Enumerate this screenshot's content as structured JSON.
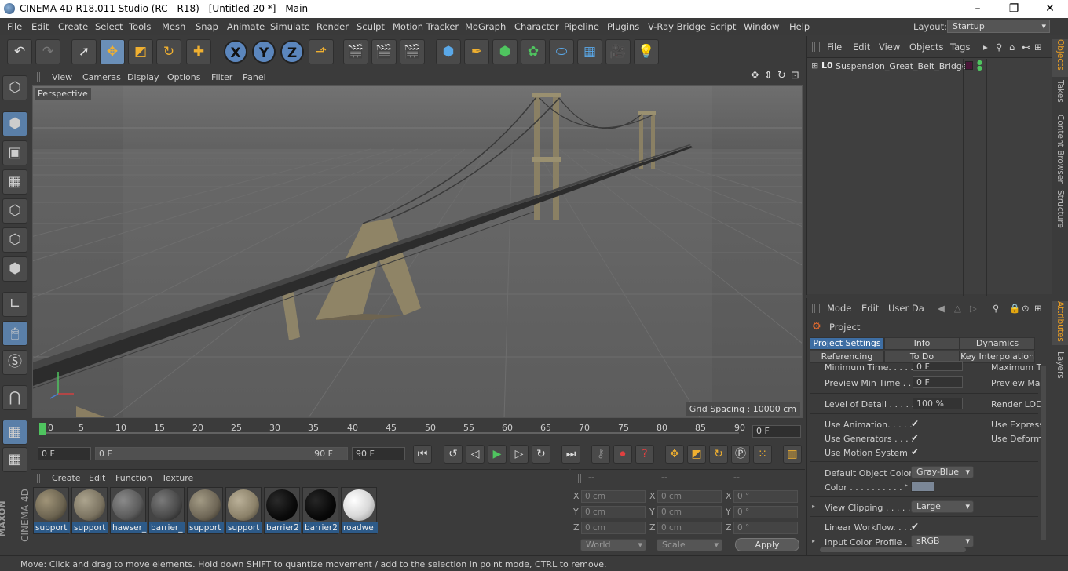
{
  "window": {
    "title": "CINEMA 4D R18.011 Studio (RC - R18) - [Untitled 20 *] - Main",
    "minimize": "–",
    "maximize": "❐",
    "close": "✕"
  },
  "menubar": {
    "items": [
      "File",
      "Edit",
      "Create",
      "Select",
      "Tools",
      "Mesh",
      "Snap",
      "Animate",
      "Simulate",
      "Render",
      "Sculpt",
      "Motion Tracker",
      "MoGraph",
      "Character",
      "Pipeline",
      "Plugins",
      "V-Ray Bridge",
      "Script",
      "Window",
      "Help"
    ],
    "layout_label": "Layout:",
    "layout_value": "Startup"
  },
  "toolbar": {
    "axis_x": "X",
    "axis_y": "Y",
    "axis_z": "Z"
  },
  "viewport": {
    "menu": [
      "View",
      "Cameras",
      "Display",
      "Options",
      "Filter",
      "Panel"
    ],
    "camera_label": "Perspective",
    "grid_spacing": "Grid Spacing : 10000 cm"
  },
  "timeline": {
    "ticks": [
      "0",
      "5",
      "10",
      "15",
      "20",
      "25",
      "30",
      "35",
      "40",
      "45",
      "50",
      "55",
      "60",
      "65",
      "70",
      "75",
      "80",
      "85",
      "90"
    ],
    "current_frame": "0 F",
    "start": "0 F",
    "range_start": "0 F",
    "range_end": "90 F",
    "end": "90 F"
  },
  "materials": {
    "menu": [
      "Create",
      "Edit",
      "Function",
      "Texture"
    ],
    "items": [
      {
        "name": "support",
        "color": "#6b6350"
      },
      {
        "name": "support",
        "color": "#7a7260"
      },
      {
        "name": "hawser_",
        "color": "#5a5a5a"
      },
      {
        "name": "barrier_",
        "color": "#484848"
      },
      {
        "name": "support",
        "color": "#6e6656"
      },
      {
        "name": "support",
        "color": "#8a8068"
      },
      {
        "name": "barrier2",
        "color": "#0a0a0a"
      },
      {
        "name": "barrier2",
        "color": "#080808"
      },
      {
        "name": "roadwe",
        "color": "#d8d8d8"
      }
    ]
  },
  "coords": {
    "header": [
      "--",
      "--",
      "--"
    ],
    "rows": [
      {
        "a": "X",
        "v1": "0 cm",
        "b": "X",
        "v2": "0 cm",
        "c": "X",
        "v3": "0 °"
      },
      {
        "a": "Y",
        "v1": "0 cm",
        "b": "Y",
        "v2": "0 cm",
        "c": "Y",
        "v3": "0 °"
      },
      {
        "a": "Z",
        "v1": "0 cm",
        "b": "Z",
        "v2": "0 cm",
        "c": "Z",
        "v3": "0 °"
      }
    ],
    "mode": "World",
    "scale": "Scale",
    "apply": "Apply"
  },
  "objects": {
    "menu": [
      "File",
      "Edit",
      "View",
      "Objects",
      "Tags"
    ],
    "items": [
      {
        "layer": "L0",
        "name": "Suspension_Great_Belt_Bridge"
      }
    ]
  },
  "attributes": {
    "menu": [
      "Mode",
      "Edit",
      "User Da"
    ],
    "title": "Project",
    "tabs_row1": [
      "Project Settings",
      "Info",
      "Dynamics"
    ],
    "tabs_row2": [
      "Referencing",
      "To Do",
      "Key Interpolation"
    ],
    "min_time_label": "Minimum Time. . . . .",
    "min_time": "0 F",
    "max_time_label": "Maximum T",
    "preview_min_label": "Preview Min Time . .",
    "preview_min": "0 F",
    "preview_max_label": "Preview Ma",
    "lod_label": "Level of Detail . . . . .",
    "lod": "100 %",
    "render_lod_label": "Render LOD",
    "use_anim_label": "Use Animation. . . . .",
    "use_expr_label": "Use Express",
    "use_gen_label": "Use Generators . . . .",
    "use_deform_label": "Use Deform",
    "use_motion_label": "Use Motion System",
    "def_color_label": "Default Object Color",
    "def_color": "Gray-Blue",
    "color_label": "Color . . . . . . . . . .",
    "color_swatch": "#7b8797",
    "view_clip_label": "View Clipping . . . . .",
    "view_clip": "Large",
    "linear_label": "Linear Workflow. . . .",
    "input_profile_label": "Input Color Profile . .",
    "input_profile": "sRGB"
  },
  "sidetabs": {
    "top": [
      "Objects",
      "Takes",
      "Content Browser",
      "Structure"
    ],
    "bottom": [
      "Attributes",
      "Layers"
    ]
  },
  "status": "Move: Click and drag to move elements. Hold down SHIFT to quantize movement / add to the selection in point mode, CTRL to remove."
}
